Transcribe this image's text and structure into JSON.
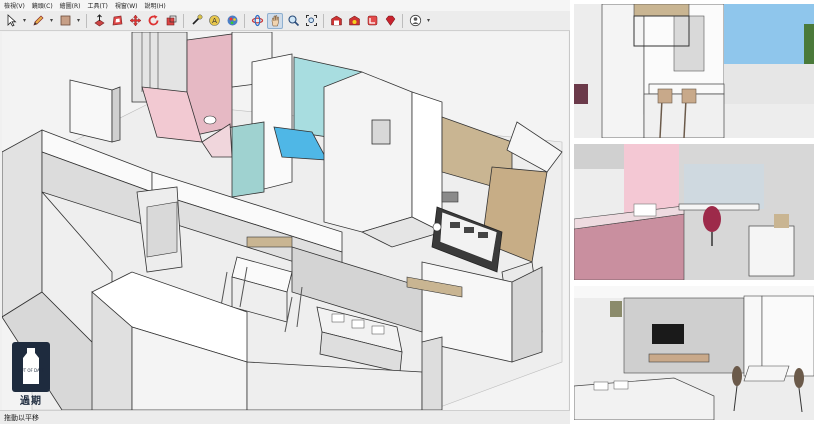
{
  "menu": {
    "items": [
      "檢視(V)",
      "鏡頭(C)",
      "繪圖(R)",
      "工具(T)",
      "視窗(W)",
      "說明(H)"
    ]
  },
  "toolbar": {
    "tools": [
      {
        "name": "select-tool",
        "icon": "arrow-icon"
      },
      {
        "name": "line-tool",
        "icon": "pencil-icon"
      },
      {
        "name": "rectangle-tool",
        "icon": "rectangle-icon"
      },
      {
        "name": "push-pull-tool",
        "icon": "push-pull-icon"
      },
      {
        "name": "offset-tool",
        "icon": "offset-icon"
      },
      {
        "name": "move-tool",
        "icon": "move-icon"
      },
      {
        "name": "rotate-tool",
        "icon": "rotate-icon"
      },
      {
        "name": "scale-tool",
        "icon": "scale-icon"
      },
      {
        "name": "tape-tool",
        "icon": "tape-measure-icon"
      },
      {
        "name": "text-tool",
        "icon": "text-icon"
      },
      {
        "name": "paint-tool",
        "icon": "paint-bucket-icon"
      },
      {
        "name": "orbit-tool",
        "icon": "orbit-icon"
      },
      {
        "name": "pan-tool",
        "icon": "pan-hand-icon"
      },
      {
        "name": "zoom-tool",
        "icon": "zoom-icon"
      },
      {
        "name": "zoom-extents-tool",
        "icon": "zoom-extents-icon"
      },
      {
        "name": "3d-warehouse",
        "icon": "warehouse-icon"
      },
      {
        "name": "extension-warehouse",
        "icon": "extension-icon"
      },
      {
        "name": "layout",
        "icon": "layout-icon"
      },
      {
        "name": "extension-manager",
        "icon": "ruby-icon"
      },
      {
        "name": "account",
        "icon": "account-icon"
      }
    ],
    "active_tool": "pan-tool",
    "accent": "#8fb0d0"
  },
  "status": {
    "text": "拖動以平移"
  },
  "watermark": {
    "text": "過期",
    "caption": "OUT OF DATE"
  },
  "colors": {
    "pink_room": "#e6b9c4",
    "cyan_room": "#a8dde0",
    "wood": "#c9b592",
    "floor_gray": "#d4d4d4",
    "wall_white": "#f7f7f7",
    "sky": "#8fc6ec"
  }
}
